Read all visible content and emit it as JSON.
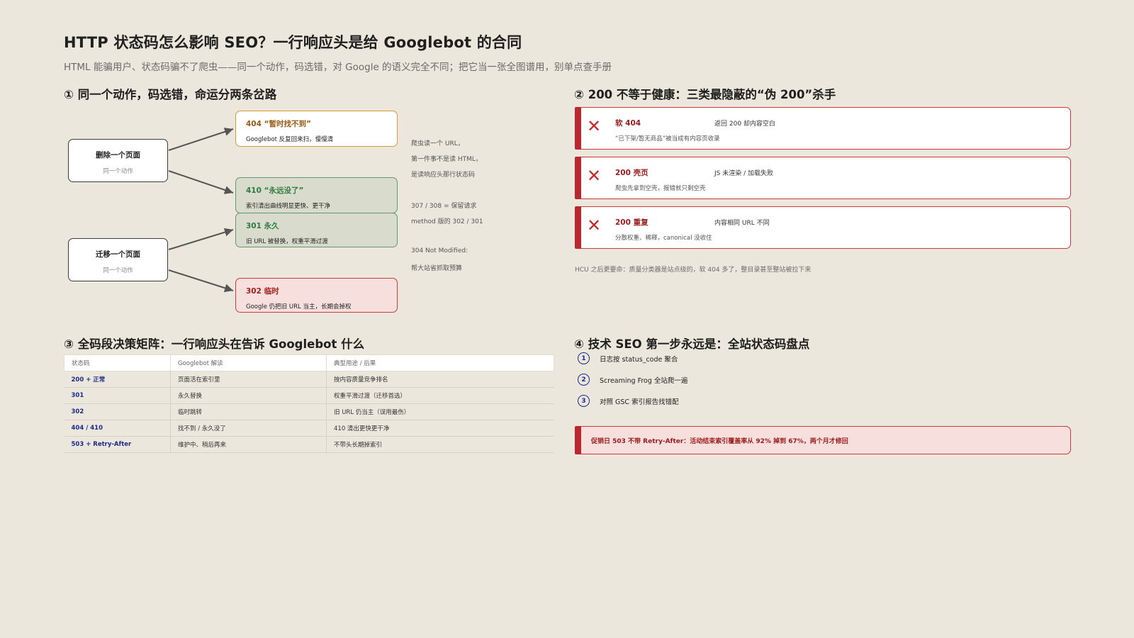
{
  "header": {
    "title": "HTTP 状态码怎么影响 SEO？一行响应头是给 Googlebot 的合同",
    "subtitle": "HTML 能骗用户、状态码骗不了爬虫——同一个动作，码选错，对 Google 的语义完全不同；把它当一张全图谱用，别单点查手册"
  },
  "section1": {
    "title": "① 同一个动作，码选错，命运分两条岔路",
    "sources": [
      {
        "title": "删除一个页面",
        "sub": "同一个动作"
      },
      {
        "title": "迁移一个页面",
        "sub": "同一个动作"
      }
    ],
    "outcomes": [
      {
        "head": "404 “暂时找不到”",
        "desc": "Googlebot 反复回来扫，慢慢清"
      },
      {
        "head": "410 “永远没了”",
        "desc": "索引清出曲线明显更快、更干净"
      },
      {
        "head": "301 永久",
        "desc": "旧 URL 被替换，权重平滑过渡"
      },
      {
        "head": "302 临时",
        "desc": "Google 仍把旧 URL 当主，长期会掉权"
      }
    ],
    "notes": [
      "爬虫读一个 URL，",
      "第一件事不是读 HTML，",
      "是读响应头那行状态码",
      "307 / 308 = 保留请求",
      "method 版的 302 / 301",
      "304 Not Modified:",
      "帮大站省抓取预算"
    ]
  },
  "section2": {
    "title": "② 200 不等于健康：三类最隐蔽的“伪 200”杀手",
    "cards": [
      {
        "icon": "✕",
        "name": "软 404",
        "symptom": "返回 200 却内容空白",
        "desc": "“已下架/暂无商品”被当成有内容页收录"
      },
      {
        "icon": "✕",
        "name": "200 壳页",
        "symptom": "JS 未渲染 / 加载失败",
        "desc": "爬虫先拿到空壳，报错就只剩空壳"
      },
      {
        "icon": "✕",
        "name": "200 重复",
        "symptom": "内容相同 URL 不同",
        "desc": "分散权重、稀释，canonical 没收住"
      }
    ],
    "footnote": "HCU 之后更要命：质量分类器是站点级的，软 404 多了，整目录甚至整站被拉下来"
  },
  "section3": {
    "title": "③ 全码段决策矩阵：一行响应头在告诉 Googlebot 什么",
    "headers": [
      "状态码",
      "Googlebot 解读",
      "典型用途 / 后果"
    ],
    "rows": [
      [
        "200 + 正常",
        "页面活在索引里",
        "按内容质量竞争排名"
      ],
      [
        "301",
        "永久替换",
        "权重平滑过渡（迁移首选）"
      ],
      [
        "302",
        "临时跳转",
        "旧 URL 仍当主（误用最伤）"
      ],
      [
        "404 / 410",
        "找不到 / 永久没了",
        "410 清出更快更干净"
      ],
      [
        "503 + Retry-After",
        "维护中、稍后再来",
        "不带头长期掉索引"
      ]
    ]
  },
  "section4": {
    "title": "④ 技术 SEO 第一步永远是：全站状态码盘点",
    "steps": [
      {
        "num": "1",
        "text": "日志按 status_code 聚合"
      },
      {
        "num": "2",
        "text": "Screaming Frog 全站爬一遍"
      },
      {
        "num": "3",
        "text": "对照 GSC 索引报告找错配"
      }
    ],
    "alert": "促销日 503 不带 Retry-After：活动结束索引覆盖率从 92% 掉到 67%，两个月才修回"
  },
  "colors": {
    "background": "#ebe7dc",
    "danger": "#cc3a3a",
    "success": "#5e9a6b",
    "warning": "#d49a3a",
    "code_blue": "#1d2a8a"
  }
}
